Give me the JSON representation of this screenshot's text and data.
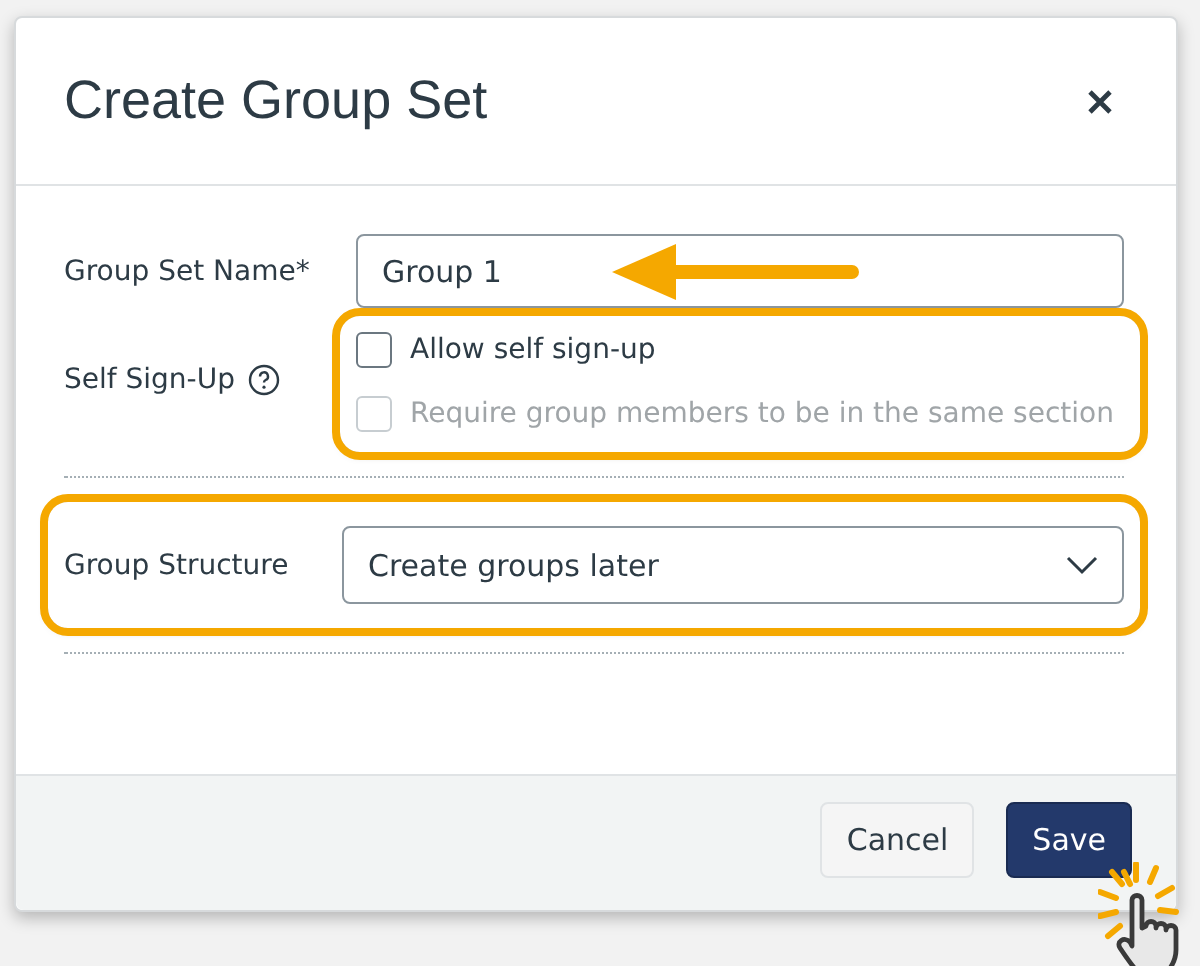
{
  "dialog": {
    "title": "Create Group Set"
  },
  "fields": [
    {
      "kind": "text",
      "label": "Group Set Name*",
      "value": "Group 1",
      "arrow": true
    },
    {
      "kind": "checkboxes",
      "label": "Self Sign-Up",
      "help": true,
      "divider_after": true,
      "highlighted": true,
      "options": [
        {
          "label": "Allow self sign-up",
          "checked": false,
          "disabled": false
        },
        {
          "label": "Require group members to be in the same section",
          "checked": false,
          "disabled": true
        }
      ]
    },
    {
      "kind": "select",
      "label": "Group Structure",
      "value": "Create groups later",
      "divider_after": true,
      "highlighted": true
    }
  ],
  "buttons": [
    {
      "label": "Cancel",
      "kind": "secondary"
    },
    {
      "label": "Save",
      "kind": "primary",
      "clicked": true
    }
  ]
}
